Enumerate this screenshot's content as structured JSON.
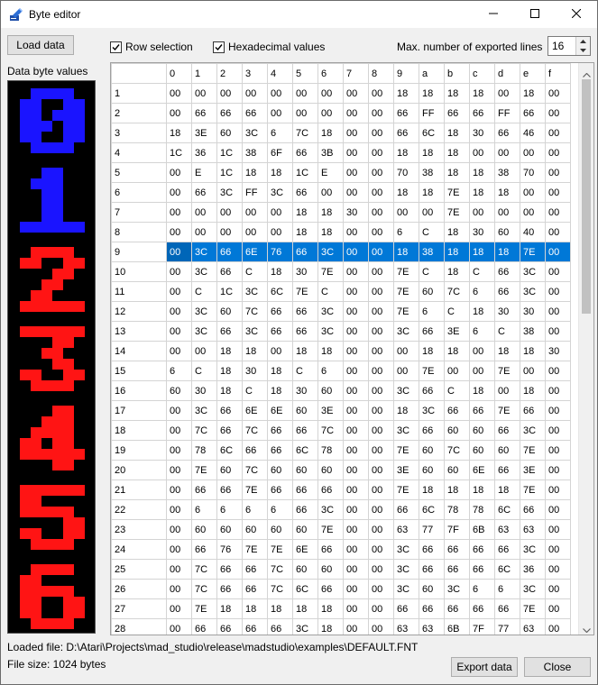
{
  "window": {
    "title": "Byte editor"
  },
  "toolbar": {
    "load_label": "Load data",
    "row_selection_label": "Row selection",
    "row_selection_checked": true,
    "hex_label": "Hexadecimal values",
    "hex_checked": true,
    "max_lines_label": "Max. number of exported lines",
    "max_lines_value": "16"
  },
  "preview": {
    "label": "Data byte values",
    "glyphs": [
      {
        "char": "0",
        "color": "#1a14ff"
      },
      {
        "char": "1",
        "color": "#1a14ff"
      },
      {
        "char": "2",
        "color": "#ff1414"
      },
      {
        "char": "3",
        "color": "#ff1414"
      },
      {
        "char": "4",
        "color": "#ff1414"
      },
      {
        "char": "5",
        "color": "#ff1414"
      },
      {
        "char": "6",
        "color": "#ff1414"
      }
    ]
  },
  "grid": {
    "columns": [
      "0",
      "1",
      "2",
      "3",
      "4",
      "5",
      "6",
      "7",
      "8",
      "9",
      "a",
      "b",
      "c",
      "d",
      "e",
      "f"
    ],
    "selected_row": 9,
    "rows": [
      {
        "n": "1",
        "v": [
          "00",
          "00",
          "00",
          "00",
          "00",
          "00",
          "00",
          "00",
          "00",
          "18",
          "18",
          "18",
          "18",
          "00",
          "18",
          "00"
        ]
      },
      {
        "n": "2",
        "v": [
          "00",
          "66",
          "66",
          "66",
          "00",
          "00",
          "00",
          "00",
          "00",
          "66",
          "FF",
          "66",
          "66",
          "FF",
          "66",
          "00"
        ]
      },
      {
        "n": "3",
        "v": [
          "18",
          "3E",
          "60",
          "3C",
          "6",
          "7C",
          "18",
          "00",
          "00",
          "66",
          "6C",
          "18",
          "30",
          "66",
          "46",
          "00"
        ]
      },
      {
        "n": "4",
        "v": [
          "1C",
          "36",
          "1C",
          "38",
          "6F",
          "66",
          "3B",
          "00",
          "00",
          "18",
          "18",
          "18",
          "00",
          "00",
          "00",
          "00"
        ]
      },
      {
        "n": "5",
        "v": [
          "00",
          "E",
          "1C",
          "18",
          "18",
          "1C",
          "E",
          "00",
          "00",
          "70",
          "38",
          "18",
          "18",
          "38",
          "70",
          "00"
        ]
      },
      {
        "n": "6",
        "v": [
          "00",
          "66",
          "3C",
          "FF",
          "3C",
          "66",
          "00",
          "00",
          "00",
          "18",
          "18",
          "7E",
          "18",
          "18",
          "00",
          "00"
        ]
      },
      {
        "n": "7",
        "v": [
          "00",
          "00",
          "00",
          "00",
          "00",
          "18",
          "18",
          "30",
          "00",
          "00",
          "00",
          "7E",
          "00",
          "00",
          "00",
          "00"
        ]
      },
      {
        "n": "8",
        "v": [
          "00",
          "00",
          "00",
          "00",
          "00",
          "18",
          "18",
          "00",
          "00",
          "6",
          "C",
          "18",
          "30",
          "60",
          "40",
          "00"
        ]
      },
      {
        "n": "9",
        "v": [
          "00",
          "3C",
          "66",
          "6E",
          "76",
          "66",
          "3C",
          "00",
          "00",
          "18",
          "38",
          "18",
          "18",
          "18",
          "7E",
          "00"
        ]
      },
      {
        "n": "10",
        "v": [
          "00",
          "3C",
          "66",
          "C",
          "18",
          "30",
          "7E",
          "00",
          "00",
          "7E",
          "C",
          "18",
          "C",
          "66",
          "3C",
          "00"
        ]
      },
      {
        "n": "11",
        "v": [
          "00",
          "C",
          "1C",
          "3C",
          "6C",
          "7E",
          "C",
          "00",
          "00",
          "7E",
          "60",
          "7C",
          "6",
          "66",
          "3C",
          "00"
        ]
      },
      {
        "n": "12",
        "v": [
          "00",
          "3C",
          "60",
          "7C",
          "66",
          "66",
          "3C",
          "00",
          "00",
          "7E",
          "6",
          "C",
          "18",
          "30",
          "30",
          "00"
        ]
      },
      {
        "n": "13",
        "v": [
          "00",
          "3C",
          "66",
          "3C",
          "66",
          "66",
          "3C",
          "00",
          "00",
          "3C",
          "66",
          "3E",
          "6",
          "C",
          "38",
          "00"
        ]
      },
      {
        "n": "14",
        "v": [
          "00",
          "00",
          "18",
          "18",
          "00",
          "18",
          "18",
          "00",
          "00",
          "00",
          "18",
          "18",
          "00",
          "18",
          "18",
          "30"
        ]
      },
      {
        "n": "15",
        "v": [
          "6",
          "C",
          "18",
          "30",
          "18",
          "C",
          "6",
          "00",
          "00",
          "00",
          "7E",
          "00",
          "00",
          "7E",
          "00",
          "00"
        ]
      },
      {
        "n": "16",
        "v": [
          "60",
          "30",
          "18",
          "C",
          "18",
          "30",
          "60",
          "00",
          "00",
          "3C",
          "66",
          "C",
          "18",
          "00",
          "18",
          "00"
        ]
      },
      {
        "n": "17",
        "v": [
          "00",
          "3C",
          "66",
          "6E",
          "6E",
          "60",
          "3E",
          "00",
          "00",
          "18",
          "3C",
          "66",
          "66",
          "7E",
          "66",
          "00"
        ]
      },
      {
        "n": "18",
        "v": [
          "00",
          "7C",
          "66",
          "7C",
          "66",
          "66",
          "7C",
          "00",
          "00",
          "3C",
          "66",
          "60",
          "60",
          "66",
          "3C",
          "00"
        ]
      },
      {
        "n": "19",
        "v": [
          "00",
          "78",
          "6C",
          "66",
          "66",
          "6C",
          "78",
          "00",
          "00",
          "7E",
          "60",
          "7C",
          "60",
          "60",
          "7E",
          "00"
        ]
      },
      {
        "n": "20",
        "v": [
          "00",
          "7E",
          "60",
          "7C",
          "60",
          "60",
          "60",
          "00",
          "00",
          "3E",
          "60",
          "60",
          "6E",
          "66",
          "3E",
          "00"
        ]
      },
      {
        "n": "21",
        "v": [
          "00",
          "66",
          "66",
          "7E",
          "66",
          "66",
          "66",
          "00",
          "00",
          "7E",
          "18",
          "18",
          "18",
          "18",
          "7E",
          "00"
        ]
      },
      {
        "n": "22",
        "v": [
          "00",
          "6",
          "6",
          "6",
          "6",
          "66",
          "3C",
          "00",
          "00",
          "66",
          "6C",
          "78",
          "78",
          "6C",
          "66",
          "00"
        ]
      },
      {
        "n": "23",
        "v": [
          "00",
          "60",
          "60",
          "60",
          "60",
          "60",
          "7E",
          "00",
          "00",
          "63",
          "77",
          "7F",
          "6B",
          "63",
          "63",
          "00"
        ]
      },
      {
        "n": "24",
        "v": [
          "00",
          "66",
          "76",
          "7E",
          "7E",
          "6E",
          "66",
          "00",
          "00",
          "3C",
          "66",
          "66",
          "66",
          "66",
          "3C",
          "00"
        ]
      },
      {
        "n": "25",
        "v": [
          "00",
          "7C",
          "66",
          "66",
          "7C",
          "60",
          "60",
          "00",
          "00",
          "3C",
          "66",
          "66",
          "66",
          "6C",
          "36",
          "00"
        ]
      },
      {
        "n": "26",
        "v": [
          "00",
          "7C",
          "66",
          "66",
          "7C",
          "6C",
          "66",
          "00",
          "00",
          "3C",
          "60",
          "3C",
          "6",
          "6",
          "3C",
          "00"
        ]
      },
      {
        "n": "27",
        "v": [
          "00",
          "7E",
          "18",
          "18",
          "18",
          "18",
          "18",
          "00",
          "00",
          "66",
          "66",
          "66",
          "66",
          "66",
          "7E",
          "00"
        ]
      },
      {
        "n": "28",
        "v": [
          "00",
          "66",
          "66",
          "66",
          "66",
          "3C",
          "18",
          "00",
          "00",
          "63",
          "63",
          "6B",
          "7F",
          "77",
          "63",
          "00"
        ]
      }
    ]
  },
  "footer": {
    "loaded_file": "Loaded file: D:\\Atari\\Projects\\mad_studio\\release\\madstudio\\examples\\DEFAULT.FNT",
    "file_size": "File size: 1024 bytes",
    "export_label": "Export data",
    "close_label": "Close"
  }
}
